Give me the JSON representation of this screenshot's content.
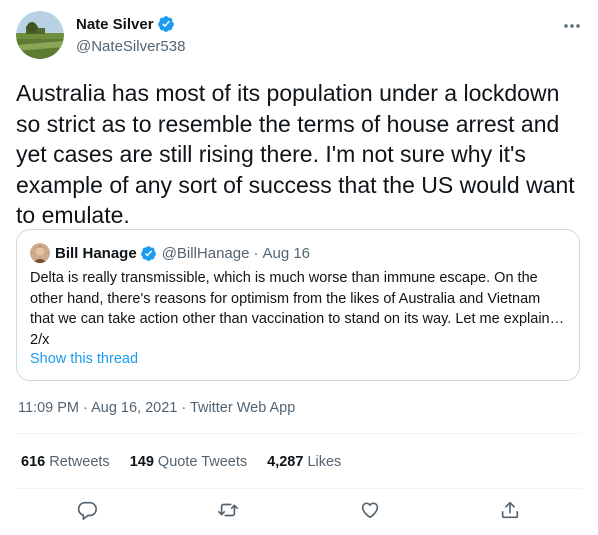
{
  "author": {
    "name": "Nate Silver",
    "handle": "@NateSilver538",
    "verified_icon": "verified-badge-icon",
    "more_icon": "more-horizontal-icon"
  },
  "tweet": {
    "text": "Australia has most of its population under a lockdown so strict as to resemble the terms of house arrest and yet cases are still rising there. I'm not sure why it's example of any sort of success that the US would want to emulate."
  },
  "quote": {
    "name": "Bill Hanage",
    "handle": "@BillHanage",
    "separator": "·",
    "date": "Aug 16",
    "text": "Delta is really transmissible, which is much worse than immune escape. On the other hand, there's reasons for optimism from the likes of Australia and Vietnam that we can take action other than vaccination to stand on its way. Let me explain… 2/x",
    "show_thread": "Show this thread"
  },
  "meta": {
    "time": "11:09 PM",
    "separator": " · ",
    "date": "Aug 16, 2021",
    "source": "Twitter Web App"
  },
  "stats": {
    "retweets_count": "616",
    "retweets_label": "Retweets",
    "quotes_count": "149",
    "quotes_label": "Quote Tweets",
    "likes_count": "4,287",
    "likes_label": "Likes"
  },
  "actions": [
    "reply-icon",
    "retweet-icon",
    "like-icon",
    "share-icon"
  ],
  "colors": {
    "accent": "#1d9bf0",
    "secondary_text": "#536471",
    "border": "#cfd9de",
    "divider": "#eff3f4"
  }
}
